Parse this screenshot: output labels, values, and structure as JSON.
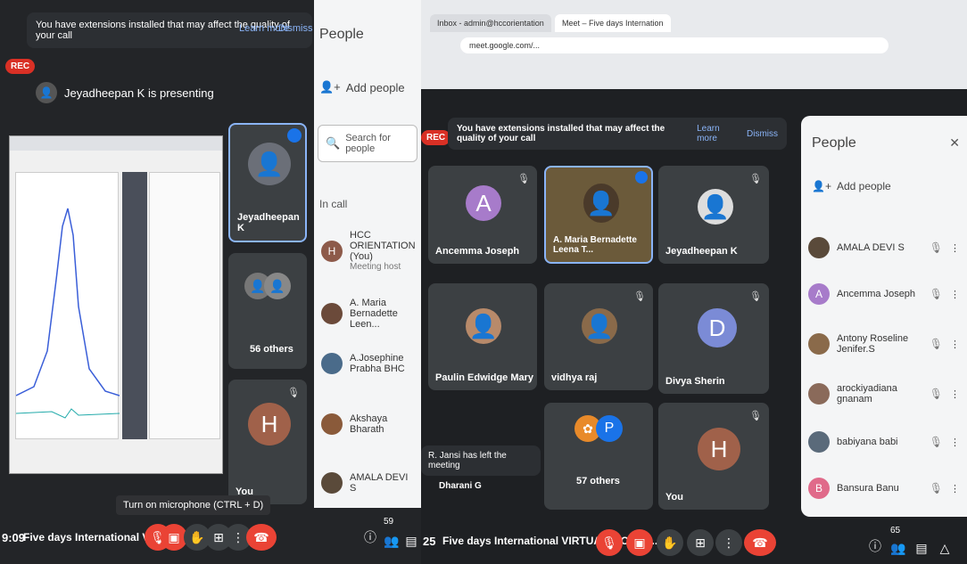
{
  "left": {
    "notification": {
      "text": "You have extensions installed that may affect the quality of your call",
      "learn_more": "Learn more",
      "dismiss": "Dismiss"
    },
    "rec": "REC",
    "presenting": "Jeyadheepan K is presenting",
    "tiles": [
      {
        "name": "Jeyadheepan K"
      },
      {
        "name": "56 others"
      },
      {
        "name": "You",
        "initial": "H"
      }
    ],
    "people": {
      "title": "People",
      "add_people": "Add people",
      "search_placeholder": "Search for people",
      "in_call": "In call",
      "items": [
        {
          "name": "HCC ORIENTATION (You)",
          "sub": "Meeting host",
          "initial": "H",
          "color": "#8d5a4a"
        },
        {
          "name": "A. Maria Bernadette Leen...",
          "initial": "",
          "color": "#6b4a3a"
        },
        {
          "name": "A.Josephine Prabha BHC",
          "initial": "",
          "color": "#4a6b8a"
        },
        {
          "name": "Akshaya Bharath",
          "initial": "",
          "color": "#8a5a3a"
        },
        {
          "name": "AMALA DEVI S",
          "initial": "",
          "color": "#5a4a3a"
        }
      ]
    },
    "tooltip": "Turn on microphone (CTRL + D)",
    "meeting_bar": {
      "time": "9:09",
      "title": "Five days International VIRTUAL WORKS..."
    },
    "people_count": "59"
  },
  "right": {
    "browser": {
      "tab1": "Inbox - admin@hccorientation",
      "tab2": "Meet – Five days Internation",
      "url": "meet.google.com/..."
    },
    "notification": {
      "text": "You have extensions installed that may affect the quality of your call",
      "learn_more": "Learn more",
      "dismiss": "Dismiss"
    },
    "rec": "REC",
    "tiles": [
      {
        "name": "Ancemma Joseph",
        "initial": "A",
        "color": "#a77bca"
      },
      {
        "name": "A. Maria Bernadette Leena T...",
        "initial": ""
      },
      {
        "name": "Jeyadheepan K",
        "initial": ""
      },
      {
        "name": "Paulin Edwidge Mary",
        "initial": ""
      },
      {
        "name": "vidhya raj",
        "initial": ""
      },
      {
        "name": "Divya Sherin",
        "initial": "D",
        "color": "#7b8bd6"
      },
      {
        "name": "57 others",
        "initial": "P",
        "color": "#1a73e8"
      },
      {
        "name": "You",
        "initial": "H",
        "color": "#a0614a"
      }
    ],
    "left_list": [
      "Dharani G"
    ],
    "toast": "R. Jansi has left the meeting",
    "people": {
      "title": "People",
      "add_people": "Add people",
      "items": [
        {
          "name": "AMALA DEVI S",
          "initial": "",
          "color": "#5a4a3a"
        },
        {
          "name": "Ancemma Joseph",
          "initial": "A",
          "color": "#a77bca"
        },
        {
          "name": "Antony Roseline Jenifer.S",
          "initial": "",
          "color": "#8a6a4a"
        },
        {
          "name": "arockiyadiana gnanam",
          "initial": "",
          "color": "#8a6a5a"
        },
        {
          "name": "babiyana babi",
          "initial": "",
          "color": "#5a6a7a"
        },
        {
          "name": "Bansura Banu",
          "initial": "B",
          "color": "#e06a8a"
        }
      ]
    },
    "meeting_bar": {
      "time": "25",
      "title": "Five days International VIRTUAL WORKS..."
    },
    "people_count": "65"
  }
}
